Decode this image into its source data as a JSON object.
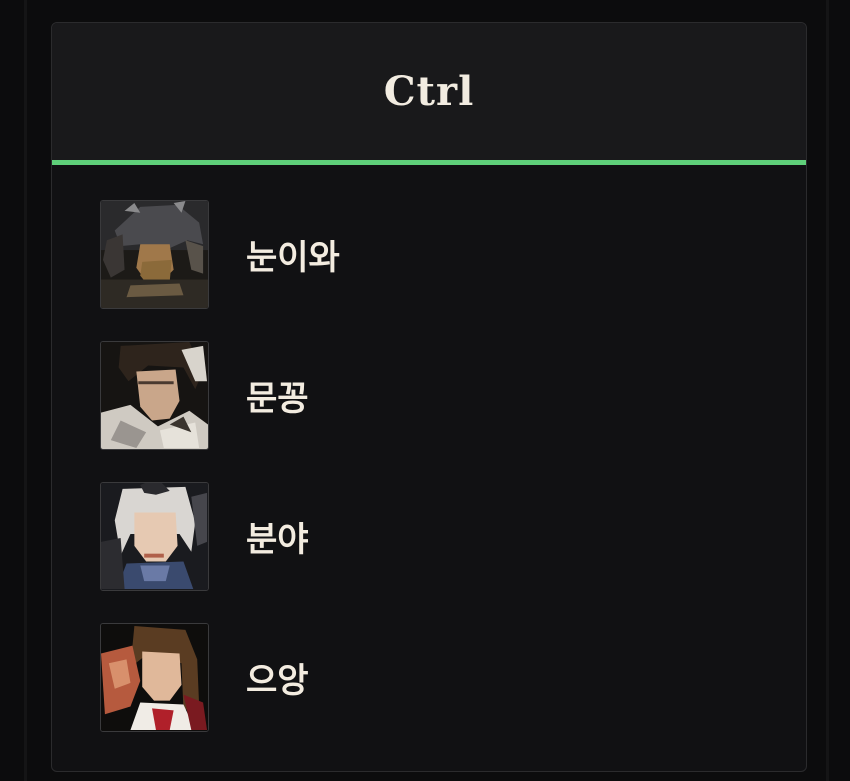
{
  "panel": {
    "title": "Ctrl",
    "accent_color": "#5fd07a"
  },
  "members": [
    {
      "name": "눈이와",
      "avatar": "armored-warrior-avatar"
    },
    {
      "name": "문꽁",
      "avatar": "dark-haired-warrior-avatar"
    },
    {
      "name": "분야",
      "avatar": "silver-haired-woman-avatar"
    },
    {
      "name": "으앙",
      "avatar": "brown-haired-woman-avatar"
    }
  ]
}
